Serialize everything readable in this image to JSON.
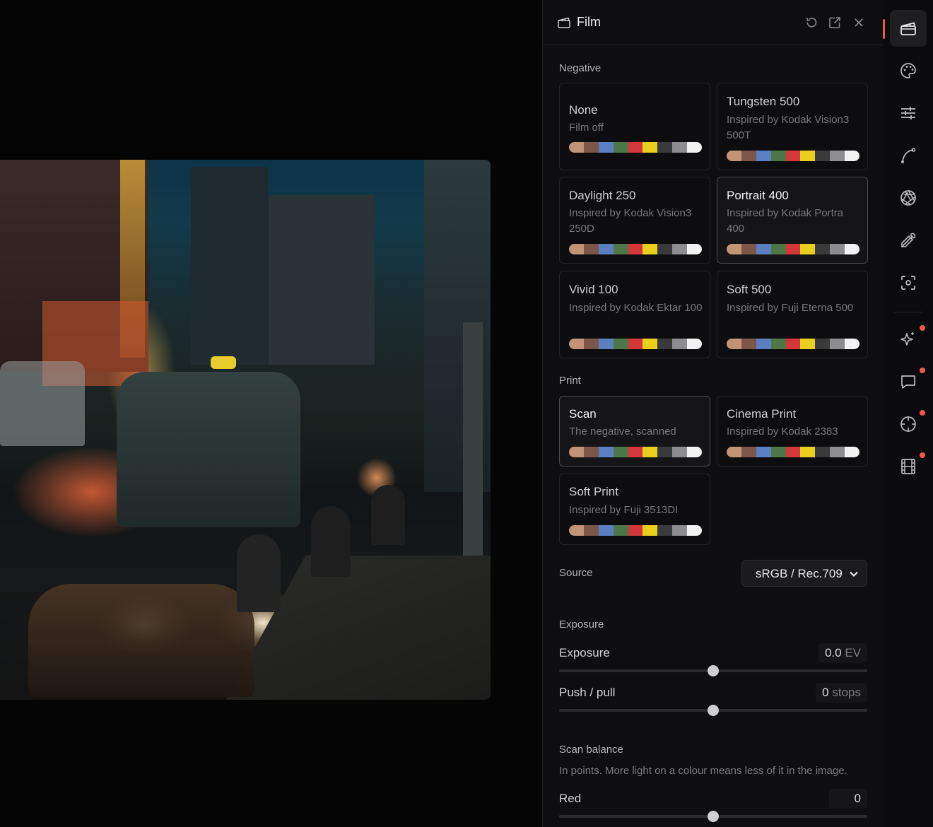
{
  "panel": {
    "title": "Film",
    "icons": [
      "film-icon",
      "reset-icon",
      "pop-out-icon",
      "close-icon"
    ]
  },
  "swatch_colors": [
    "#c19377",
    "#7e5647",
    "#5a7ebf",
    "#4e7748",
    "#d4373b",
    "#e8cf1d",
    "#3a3a3c",
    "#8d8d90",
    "#f2f2f2"
  ],
  "negative": {
    "label": "Negative",
    "cards": [
      {
        "title": "None",
        "subtitle": "Film off",
        "selected": false
      },
      {
        "title": "Tungsten 500",
        "subtitle": "Inspired by Kodak Vision3 500T",
        "selected": false
      },
      {
        "title": "Daylight 250",
        "subtitle": "Inspired by Kodak Vision3 250D",
        "selected": false
      },
      {
        "title": "Portrait 400",
        "subtitle": "Inspired by Kodak Portra 400",
        "selected": true
      },
      {
        "title": "Vivid 100",
        "subtitle": "Inspired by Kodak Ektar 100",
        "selected": false
      },
      {
        "title": "Soft 500",
        "subtitle": "Inspired by Fuji Eterna 500",
        "selected": false
      }
    ]
  },
  "print": {
    "label": "Print",
    "cards": [
      {
        "title": "Scan",
        "subtitle": "The negative, scanned",
        "selected": true
      },
      {
        "title": "Cinema Print",
        "subtitle": "Inspired by Kodak 2383",
        "selected": false
      },
      {
        "title": "Soft Print",
        "subtitle": "Inspired by Fuji 3513DI",
        "selected": false
      }
    ]
  },
  "source": {
    "label": "Source",
    "value": "sRGB / Rec.709"
  },
  "exposure": {
    "section_label": "Exposure",
    "exposure": {
      "label": "Exposure",
      "value": "0.0",
      "unit": "EV",
      "position": 0.5
    },
    "push_pull": {
      "label": "Push / pull",
      "value": "0",
      "unit": "stops",
      "position": 0.5
    }
  },
  "scan_balance": {
    "section_label": "Scan balance",
    "description": "In points. More light on a colour means less of it in the image.",
    "red": {
      "label": "Red",
      "value": "0",
      "position": 0.5
    }
  },
  "toolbar": {
    "tools": [
      {
        "name": "film-tool",
        "icon": "clapperboard-icon",
        "active": true,
        "badge": false
      },
      {
        "name": "color-tool",
        "icon": "palette-icon",
        "active": false,
        "badge": false
      },
      {
        "name": "adjust-tool",
        "icon": "sliders-icon",
        "active": false,
        "badge": false
      },
      {
        "name": "curves-tool",
        "icon": "curve-icon",
        "active": false,
        "badge": false
      },
      {
        "name": "lens-tool",
        "icon": "aperture-icon",
        "active": false,
        "badge": false
      },
      {
        "name": "picker-tool",
        "icon": "eyedropper-icon",
        "active": false,
        "badge": false
      },
      {
        "name": "focus-tool",
        "icon": "focus-icon",
        "active": false,
        "badge": false
      },
      {
        "name": "ai-tool",
        "icon": "sparkles-icon",
        "active": false,
        "badge": true
      },
      {
        "name": "comment-tool",
        "icon": "comment-icon",
        "active": false,
        "badge": true
      },
      {
        "name": "target-tool",
        "icon": "crosshair-icon",
        "active": false,
        "badge": true
      },
      {
        "name": "filmstrip-tool",
        "icon": "filmstrip-icon",
        "active": false,
        "badge": true
      }
    ]
  },
  "accent_color": "#f0574e"
}
